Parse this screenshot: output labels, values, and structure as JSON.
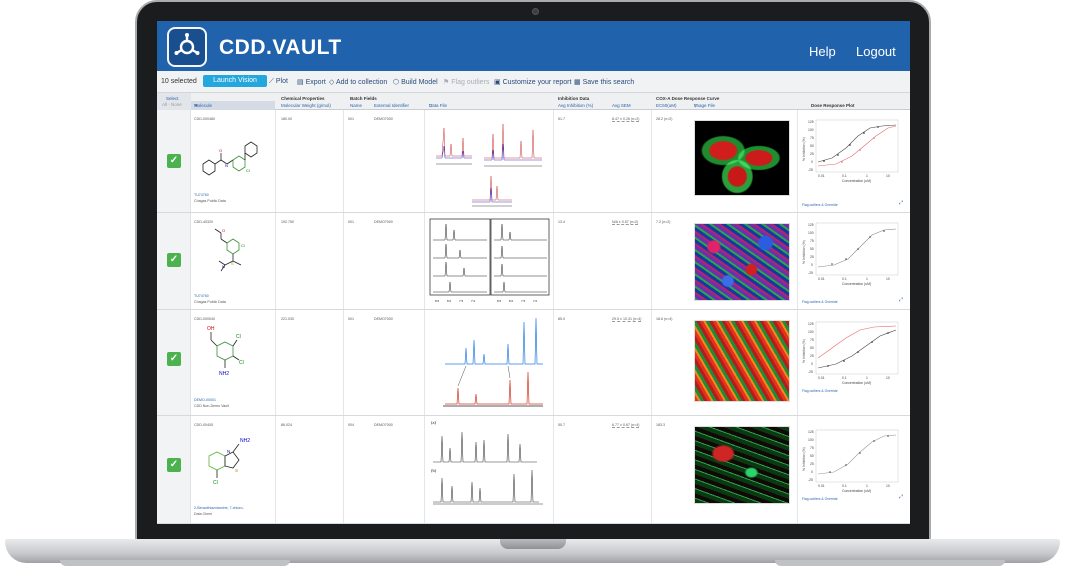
{
  "app": {
    "brand": "CDD.VAULT",
    "nav": {
      "help": "Help",
      "logout": "Logout"
    }
  },
  "toolbar": {
    "selected": "10 selected",
    "launch_vision": "Launch Vision",
    "plot": "Plot",
    "export": "Export",
    "add_to_collection": "Add to collection",
    "build_model": "Build Model",
    "flag_outliers": "Flag outliers",
    "customize_report": "Customize your report",
    "save_search": "Save this search"
  },
  "grid": {
    "select": "Select",
    "select_sub": "All · None",
    "molecule": "Molecule",
    "chem_props": "Chemical Properties",
    "mol_weight": "Molecular Weight (g/mol)",
    "batch_fields": "Batch Fields",
    "name": "Name",
    "external_id": "External Identifier",
    "data_file": "Data File",
    "inhibition_data": "Inhibition Data",
    "avg_inhibition": "Avg Inhibition (%)",
    "avg_sem": "Avg SEM",
    "cox_curve": "COX-A Dose Response Curve",
    "ec50": "EC50(uM)",
    "image_file": "Image File",
    "dose_plot": "Dose Response Plot"
  },
  "rows": [
    {
      "id": "CDD-000480",
      "mw": "180.00",
      "batch": "001",
      "ext": "DEMO7000",
      "source_link": "TU74760",
      "source": "Chagas Public Data",
      "avg_inh": "51.7",
      "sem": "8.47 ± 0.26 (n=2)",
      "ec50": "28.2 (n=2)",
      "flag": "Flag outliers & Override"
    },
    {
      "id": "CDD-40320",
      "mw": "192.750",
      "batch": "001",
      "ext": "DEMO7000",
      "source_link": "TU74760",
      "source": "Chagas Public Data",
      "avg_inh": "13.4",
      "sem": "N/A ± 0.57 (n=2)",
      "ec50": "7.2 (n=2)",
      "flag": "Flag outliers & Override"
    },
    {
      "id": "CDD-000040",
      "mw": "221.030",
      "batch": "001",
      "ext": "DEMO7000",
      "source_link": "DEMO-00001",
      "source": "CDD Non-Demo Vault",
      "avg_inh": "85.0",
      "sem": "29.5 ± 10.31 (n=4)",
      "ec50": "18.6 (n=4)",
      "flag": "Flag outliers & Override"
    },
    {
      "id": "CDD-00405",
      "mw": "86.024",
      "batch": "004",
      "ext": "DEMO7000",
      "source_link": "2-Benzothiazolamine, 7-chloro-",
      "source": "Data Chem",
      "avg_inh": "50.7",
      "sem": "6.77 ± 0.67 (n=4)",
      "ec50": "183.3",
      "flag": "Flag outliers & Override"
    }
  ],
  "atoms": {
    "n": "N",
    "o": "O",
    "s": "S",
    "cl": "Cl",
    "oh": "OH",
    "nh2": "NH2"
  },
  "plot_text": {
    "ylabel": "% Inhibition (%)",
    "xlabel": "Concentration (uM)",
    "yticks": [
      "125",
      "100",
      "75",
      "50",
      "25",
      "0",
      "-25"
    ],
    "xticks": [
      "0.01",
      "0.1",
      "1",
      "10"
    ]
  },
  "colors": {
    "brand_blue": "#2162ad",
    "accent": "#23a7dc",
    "check": "#4bb24d"
  },
  "icons": {
    "logo": "hub-logo-icon",
    "check": "check-icon",
    "expand": "expand-icon"
  }
}
